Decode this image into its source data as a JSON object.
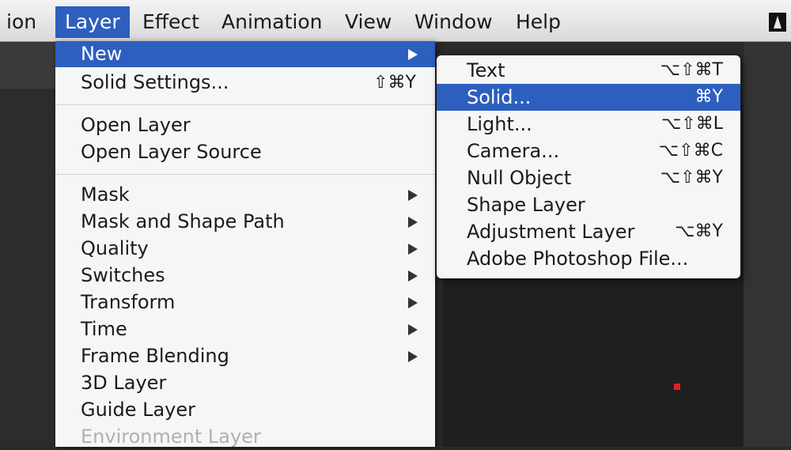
{
  "menubar": {
    "items": [
      "ion",
      "Layer",
      "Effect",
      "Animation",
      "View",
      "Window",
      "Help"
    ],
    "active_index": 1
  },
  "layer_menu": {
    "items": [
      {
        "label": "New",
        "shortcut": "",
        "submenu": true,
        "highlighted": true
      },
      {
        "label": "Solid Settings...",
        "shortcut": "⇧⌘Y",
        "submenu": false
      },
      {
        "label": "Open Layer",
        "shortcut": "",
        "submenu": false
      },
      {
        "label": "Open Layer Source",
        "shortcut": "",
        "submenu": false
      },
      {
        "label": "Mask",
        "shortcut": "",
        "submenu": true
      },
      {
        "label": "Mask and Shape Path",
        "shortcut": "",
        "submenu": true
      },
      {
        "label": "Quality",
        "shortcut": "",
        "submenu": true
      },
      {
        "label": "Switches",
        "shortcut": "",
        "submenu": true
      },
      {
        "label": "Transform",
        "shortcut": "",
        "submenu": true
      },
      {
        "label": "Time",
        "shortcut": "",
        "submenu": true
      },
      {
        "label": "Frame Blending",
        "shortcut": "",
        "submenu": true
      },
      {
        "label": "3D Layer",
        "shortcut": "",
        "submenu": false
      },
      {
        "label": "Guide Layer",
        "shortcut": "",
        "submenu": false
      },
      {
        "label": "Environment Layer",
        "shortcut": "",
        "submenu": false,
        "disabled": true
      }
    ]
  },
  "new_submenu": {
    "items": [
      {
        "label": "Text",
        "shortcut": "⌥⇧⌘T"
      },
      {
        "label": "Solid...",
        "shortcut": "⌘Y",
        "highlighted": true
      },
      {
        "label": "Light...",
        "shortcut": "⌥⇧⌘L"
      },
      {
        "label": "Camera...",
        "shortcut": "⌥⇧⌘C"
      },
      {
        "label": "Null Object",
        "shortcut": "⌥⇧⌘Y"
      },
      {
        "label": "Shape Layer",
        "shortcut": ""
      },
      {
        "label": "Adjustment Layer",
        "shortcut": "⌥⌘Y"
      },
      {
        "label": "Adobe Photoshop File...",
        "shortcut": ""
      }
    ]
  },
  "colors": {
    "highlight": "#2d5fbf",
    "menu_bg": "#f6f6f6"
  }
}
